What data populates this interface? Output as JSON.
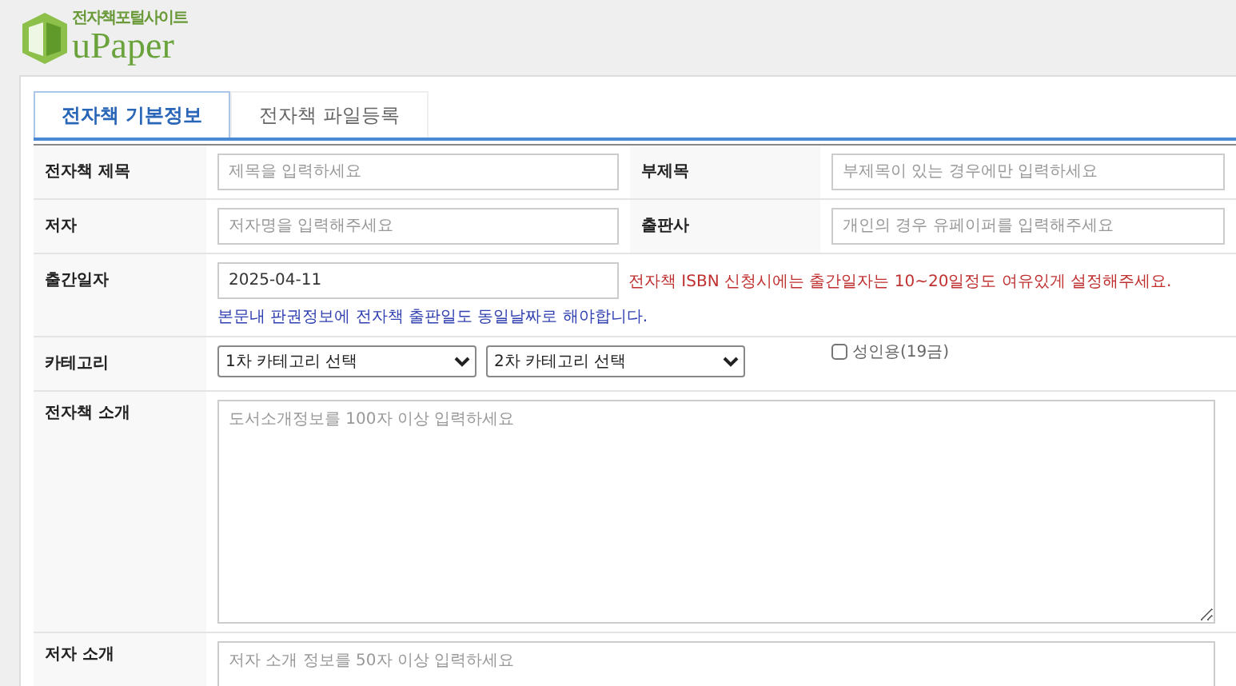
{
  "logo": {
    "tagline": "전자책포털사이트",
    "name": "uPaper"
  },
  "tabs": [
    {
      "label": "전자책 기본정보",
      "selected": true
    },
    {
      "label": "전자책 파일등록",
      "selected": false
    }
  ],
  "rows": [
    {
      "kind": "pair",
      "fields": [
        {
          "label": "전자책 제목",
          "placeholder": "제목을 입력하세요"
        },
        {
          "label": "부제목",
          "placeholder": "부제목이 있는 경우에만 입력하세요"
        }
      ]
    },
    {
      "kind": "pair",
      "fields": [
        {
          "label": "저자",
          "placeholder": "저자명을 입력해주세요"
        },
        {
          "label": "출판사",
          "placeholder": "개인의 경우 유페이퍼를 입력해주세요"
        }
      ]
    },
    {
      "kind": "date",
      "label": "출간일자",
      "value": "2025-04-11",
      "warning": "전자책 ISBN 신청시에는 출간일자는 10~20일정도 여유있게 설정해주세요.",
      "note": "본문내 판권정보에 전자책 출판일도 동일날짜로 해야합니다."
    },
    {
      "kind": "category",
      "label": "카테고리",
      "selects": [
        "1차 카테고리 선택",
        "2차 카테고리 선택"
      ],
      "checkbox": {
        "label": "성인용(19금)",
        "checked": false
      }
    },
    {
      "kind": "textarea",
      "label": "전자책 소개",
      "placeholder": "도서소개정보를 100자 이상 입력하세요"
    },
    {
      "kind": "textarea",
      "label": "저자 소개",
      "placeholder": "저자 소개 정보를 50자 이상 입력하세요"
    }
  ]
}
